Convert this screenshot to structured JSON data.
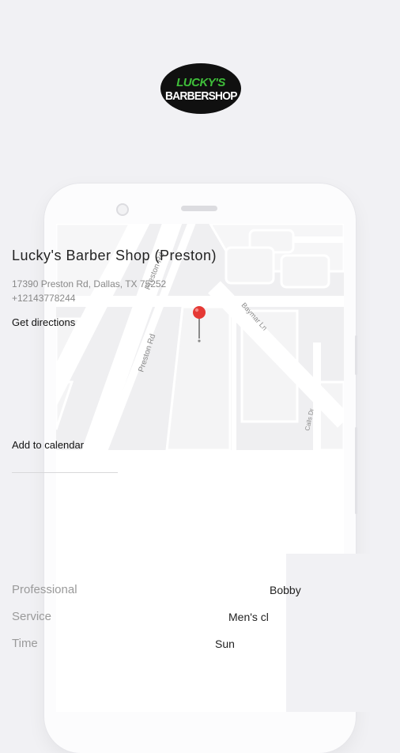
{
  "logo": {
    "line1": "LUCKY'S",
    "line2": "BARBERSHOP"
  },
  "map": {
    "streets": [
      "Preston Rd",
      "Preston Rd",
      "Baymar Ln",
      "Calls Dr"
    ],
    "pin_color": "#e53935"
  },
  "shop": {
    "name": "Lucky's Barber Shop (Preston)",
    "address": "17390 Preston Rd, Dallas, TX 75252",
    "phone": "+12143778244",
    "directions_label": "Get directions"
  },
  "booking": {
    "rows": [
      {
        "label": "Professional",
        "value": "Bobby"
      },
      {
        "label": "Service",
        "value": "Men's cl"
      },
      {
        "label": "Time",
        "value": "Sun"
      }
    ],
    "calendar_label": "Add to calendar"
  }
}
